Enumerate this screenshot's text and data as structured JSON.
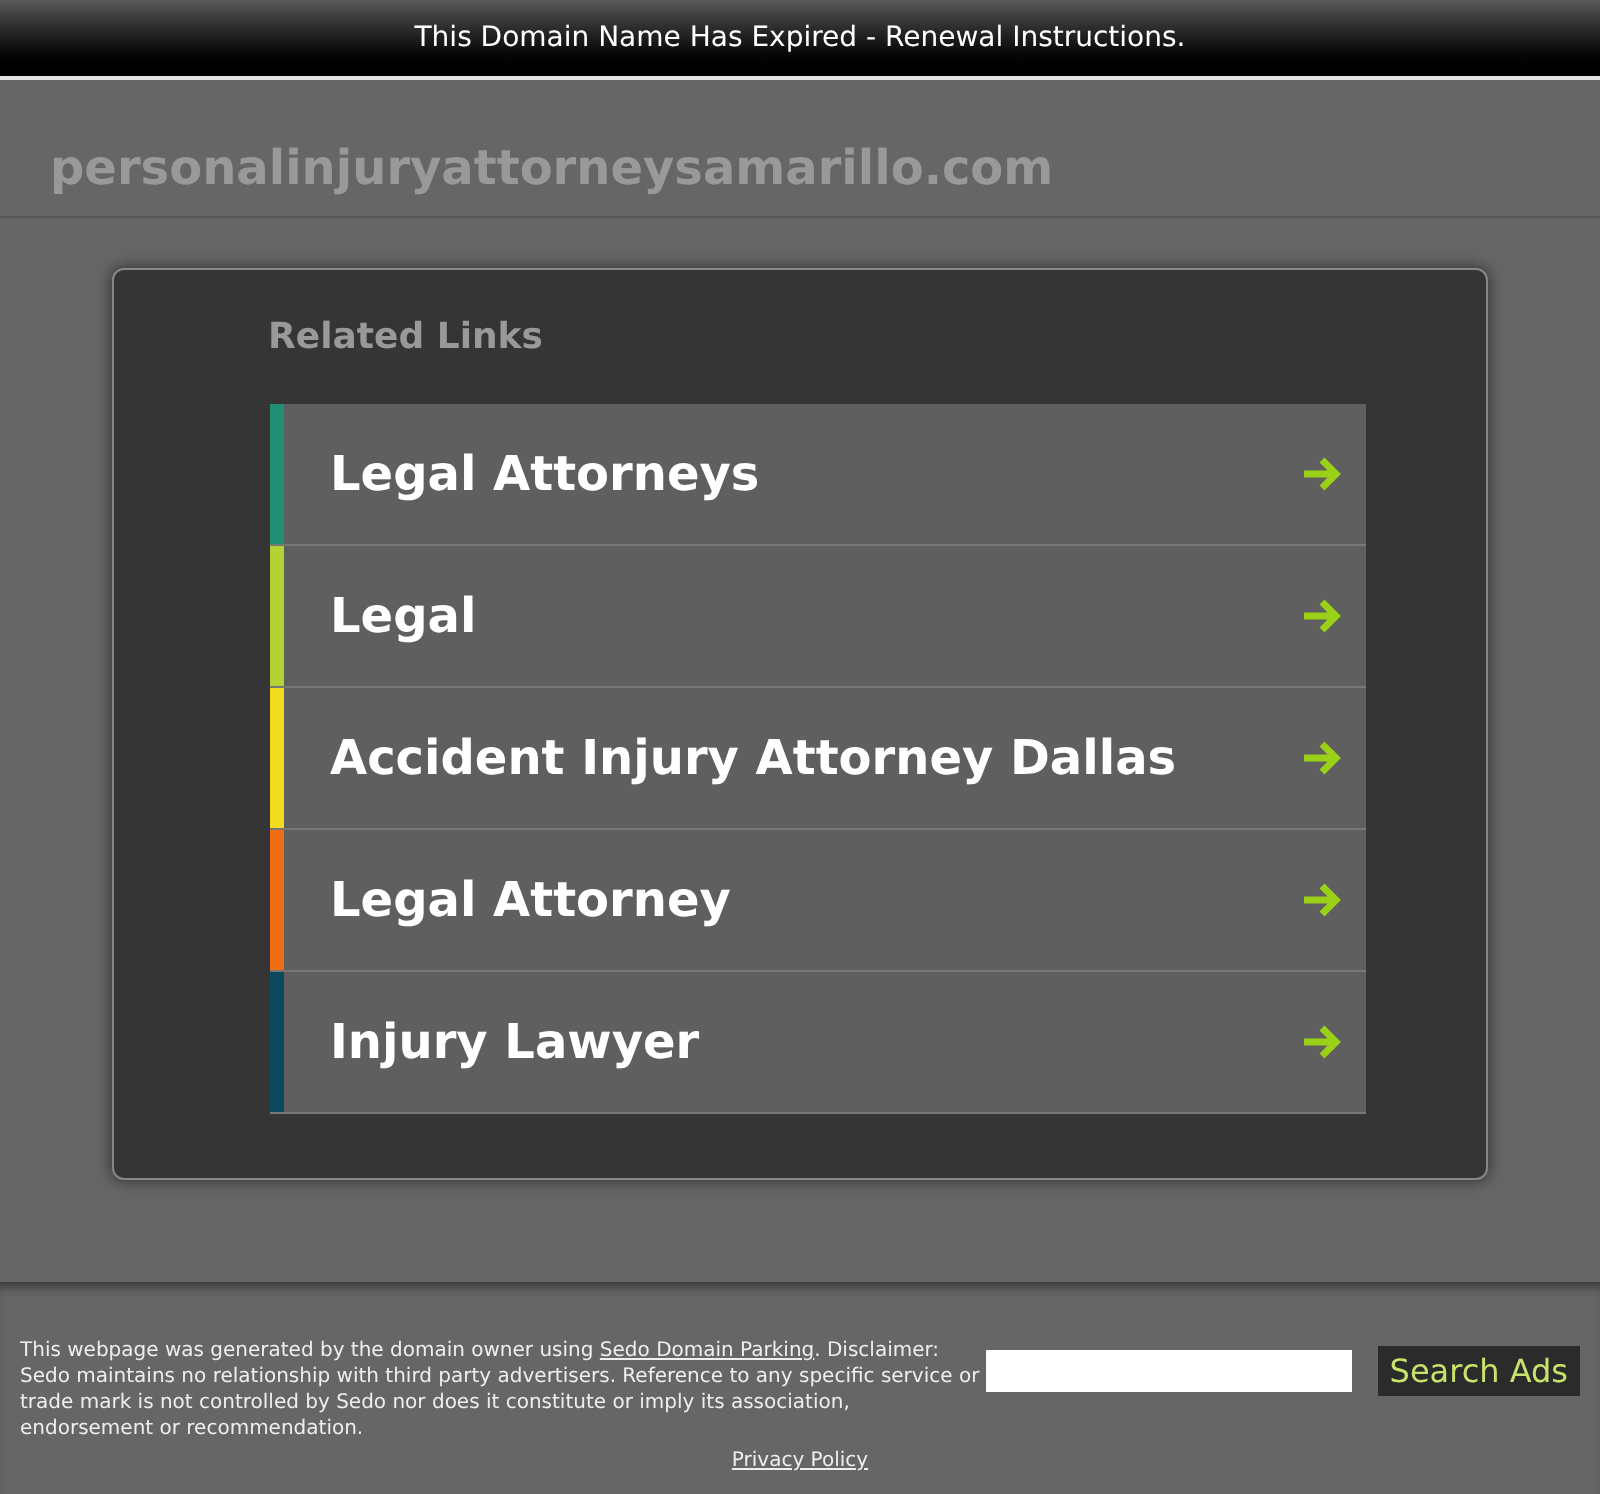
{
  "top_bar": {
    "text": "This Domain Name Has Expired - Renewal Instructions."
  },
  "domain": "personalinjuryattorneysamarillo.com",
  "related_links": {
    "title": "Related Links",
    "links": [
      {
        "label": "Legal Attorneys",
        "color": "#1f9073"
      },
      {
        "label": "Legal",
        "color": "#b3d234"
      },
      {
        "label": "Accident Injury Attorney Dallas",
        "color": "#f2dc1d"
      },
      {
        "label": "Legal Attorney",
        "color": "#ee6c12"
      },
      {
        "label": "Injury Lawyer",
        "color": "#0b4a5c"
      }
    ]
  },
  "footer": {
    "disclaimer_before": "This webpage was generated by the domain owner using",
    "disclaimer_link": "Sedo Domain Parking",
    "disclaimer_after": ". Disclaimer: Sedo maintains no relationship with third party advertisers. Reference to any specific service or trade mark is not controlled by Sedo nor does it constitute or imply its association, endorsement or recommendation.",
    "search_button": "Search Ads",
    "privacy_link": "Privacy Policy"
  }
}
